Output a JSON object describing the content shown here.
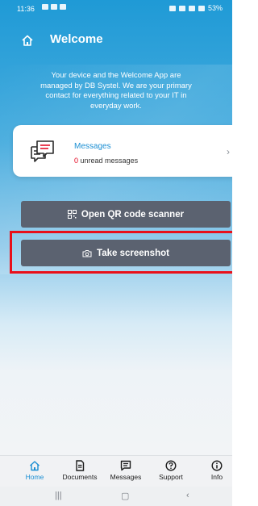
{
  "status_bar": {
    "time": "11:36",
    "battery": "53%"
  },
  "header": {
    "title": "Welcome",
    "intro": "Your device and the Welcome App are managed by DB Systel. We are your primary contact for everything related to your IT in everyday work."
  },
  "messages_card": {
    "title": "Messages",
    "unread_count": "0",
    "unread_label": "unread messages"
  },
  "actions": {
    "qr_label": "Open QR code scanner",
    "screenshot_label": "Take screenshot"
  },
  "bottom_nav": {
    "items": [
      {
        "label": "Home",
        "icon": "home-icon"
      },
      {
        "label": "Documents",
        "icon": "document-icon"
      },
      {
        "label": "Messages",
        "icon": "message-icon"
      },
      {
        "label": "Support",
        "icon": "help-icon"
      },
      {
        "label": "Info",
        "icon": "info-icon"
      }
    ]
  },
  "colors": {
    "accent": "#1b8fd3",
    "button": "#5b6270",
    "highlight": "#e8101a",
    "unread": "#e3001b"
  }
}
